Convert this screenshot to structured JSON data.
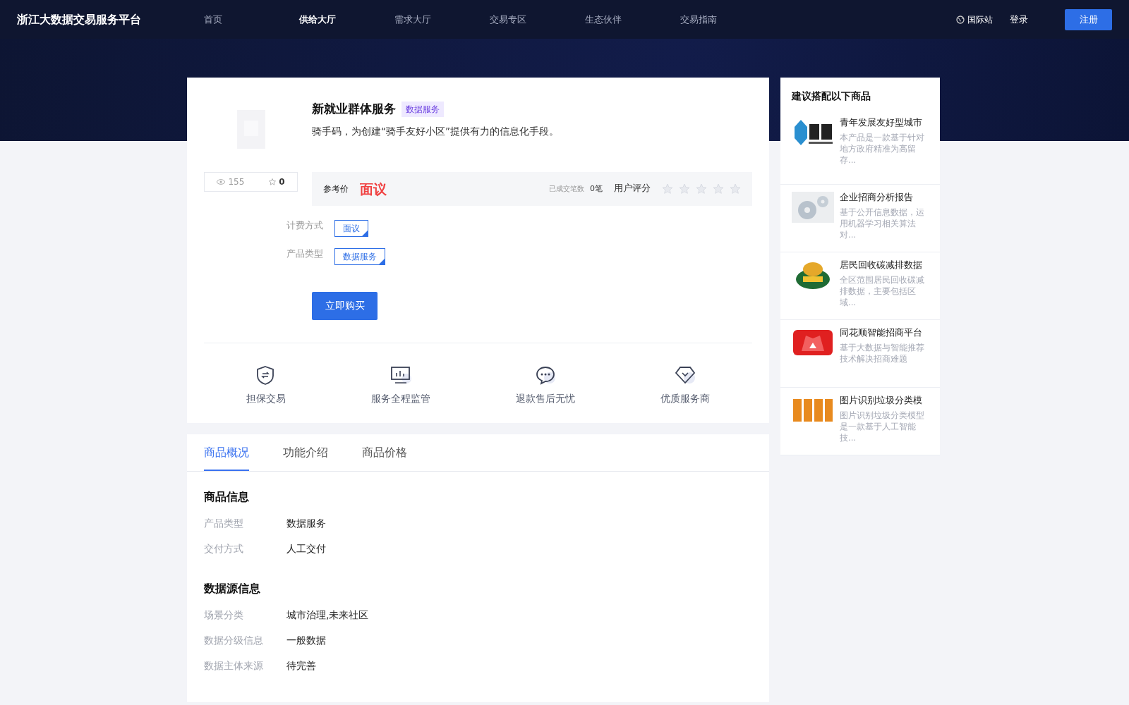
{
  "header": {
    "logo": "浙江大数据交易服务平台",
    "nav": [
      {
        "label": "首页",
        "selected": false
      },
      {
        "label": "供给大厅",
        "selected": true
      },
      {
        "label": "需求大厅",
        "selected": false
      },
      {
        "label": "交易专区",
        "selected": false
      },
      {
        "label": "生态伙伴",
        "selected": false
      },
      {
        "label": "交易指南",
        "selected": false
      }
    ],
    "intl": "国际站",
    "login": "登录",
    "register": "注册"
  },
  "product": {
    "title": "新就业群体服务",
    "tag": "数据服务",
    "description": "骑手码，为创建“骑手友好小区”提供有力的信息化手段。",
    "views": "155",
    "favorites": "0",
    "price_label": "参考价",
    "price": "面议",
    "deals_label": "已成交笔数",
    "deals": "0笔",
    "rating_label": "用户评分",
    "stars": 0,
    "options": [
      {
        "label": "计费方式",
        "chips": [
          {
            "label": "面议",
            "selected": true
          }
        ]
      },
      {
        "label": "产品类型",
        "chips": [
          {
            "label": "数据服务",
            "selected": true
          }
        ]
      }
    ],
    "buy": "立即购买",
    "guarantees": [
      {
        "kind": "shield",
        "label": "担保交易"
      },
      {
        "kind": "monitor",
        "label": "服务全程监管"
      },
      {
        "kind": "chat",
        "label": "退款售后无忧"
      },
      {
        "kind": "diamond",
        "label": "优质服务商"
      }
    ]
  },
  "tabs": [
    {
      "label": "商品概况",
      "selected": true
    },
    {
      "label": "功能介绍",
      "selected": false
    },
    {
      "label": "商品价格",
      "selected": false
    }
  ],
  "sections": [
    {
      "title": "商品信息",
      "rows": [
        {
          "label": "产品类型",
          "value": "数据服务"
        },
        {
          "label": "交付方式",
          "value": "人工交付"
        }
      ]
    },
    {
      "title": "数据源信息",
      "rows": [
        {
          "label": "场景分类",
          "value": "城市治理,未来社区"
        },
        {
          "label": "数据分级信息",
          "value": "一般数据"
        },
        {
          "label": "数据主体来源",
          "value": "待完善"
        }
      ]
    }
  ],
  "sidebar": {
    "title": "建议搭配以下商品",
    "items": [
      {
        "kind": "picture",
        "title": "青年发展友好型城市",
        "description": "本产品是一款基于针对地方政府精准为高留存..."
      },
      {
        "kind": "picture",
        "title": "企业招商分析报告",
        "description": "基于公开信息数据，运用机器学习相关算法对..."
      },
      {
        "kind": "picture",
        "title": "居民回收碳减排数据",
        "description": "全区范围居民回收碳减排数据，主要包括区域..."
      },
      {
        "kind": "picture",
        "title": "同花顺智能招商平台",
        "description": "基于大数据与智能推荐技术解决招商难题"
      },
      {
        "kind": "picture",
        "title": "图片识别垃圾分类模",
        "description": "图片识别垃圾分类模型是一款基于人工智能技..."
      }
    ]
  }
}
